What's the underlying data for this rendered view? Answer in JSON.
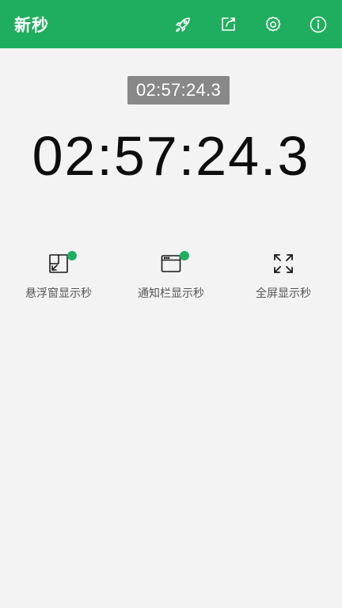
{
  "appbar": {
    "title": "新秒",
    "actions": [
      {
        "icon": "rocket-icon"
      },
      {
        "icon": "share-icon"
      },
      {
        "icon": "gear-icon"
      },
      {
        "icon": "info-icon"
      }
    ]
  },
  "clock": {
    "small_time": "02:57:24.3",
    "big_time": "02:57:24.3"
  },
  "modes": [
    {
      "label": "悬浮窗显示秒",
      "icon": "floating-window-icon",
      "enabled": true
    },
    {
      "label": "通知栏显示秒",
      "icon": "notification-bar-icon",
      "enabled": true
    },
    {
      "label": "全屏显示秒",
      "icon": "fullscreen-icon",
      "enabled": false
    }
  ],
  "colors": {
    "accent": "#1fae5f",
    "background": "#f3f3f3",
    "badge": "#888888"
  }
}
